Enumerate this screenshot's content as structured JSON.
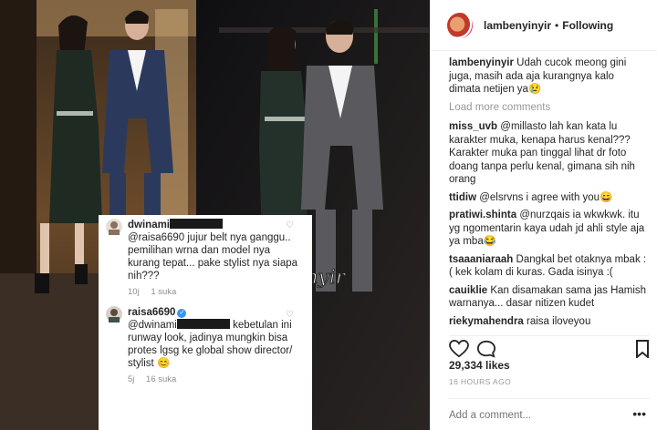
{
  "post": {
    "watermark": "@lambenyinyir",
    "screenshot_comments": [
      {
        "user": "dwinami",
        "text_prefix": "@raisa6690 jujur belt nya ganggu.. pemilihan wrna dan model nya kurang tepat... pake stylist nya siapa nih???",
        "time": "10j",
        "likes": "1 suka"
      },
      {
        "user": "raisa6690",
        "mention": "@dwinami",
        "text": "kebetulan ini runway look, jadinya mungkin bisa protes lgsg ke global show director/ stylist 😊",
        "time": "5j",
        "likes": "16 suka"
      }
    ]
  },
  "header": {
    "username": "lambenyinyir",
    "separator": "•",
    "follow_status": "Following"
  },
  "caption": {
    "user": "lambenyinyir",
    "text": "Udah cucok meong gini juga, masih ada aja kurangnya kalo dimata netijen ya😢"
  },
  "load_more": "Load more comments",
  "comments": [
    {
      "user": "miss_uvb",
      "text": "@millasto lah kan kata lu karakter muka, kenapa harus kenal??? Karakter muka pan tinggal lihat dr foto doang tanpa perlu kenal, gimana sih nih orang"
    },
    {
      "user": "ttidiw",
      "text": "@elsrvns i agree with you😄"
    },
    {
      "user": "pratiwi.shinta",
      "text": "@nurzqais ia wkwkwk. itu yg ngomentarin kaya udah jd ahli style aja ya mba😂"
    },
    {
      "user": "tsaaaniaraah",
      "text": "Dangkal bet otaknya mbak :( kek kolam di kuras. Gada isinya :("
    },
    {
      "user": "cauiklie",
      "text": "Kan disamakan sama jas Hamish warnanya... dasar nitizen kudet"
    },
    {
      "user": "riekymahendra",
      "text": "raisa iloveyou"
    }
  ],
  "likes_count": "29,334 likes",
  "time_ago": "16 HOURS AGO",
  "add_comment_placeholder": "Add a comment...",
  "colors": {
    "verified": "#3897f0",
    "muted": "#999999",
    "text": "#262626"
  },
  "icons": [
    "heart-icon",
    "comment-icon",
    "bookmark-icon",
    "more-icon"
  ]
}
